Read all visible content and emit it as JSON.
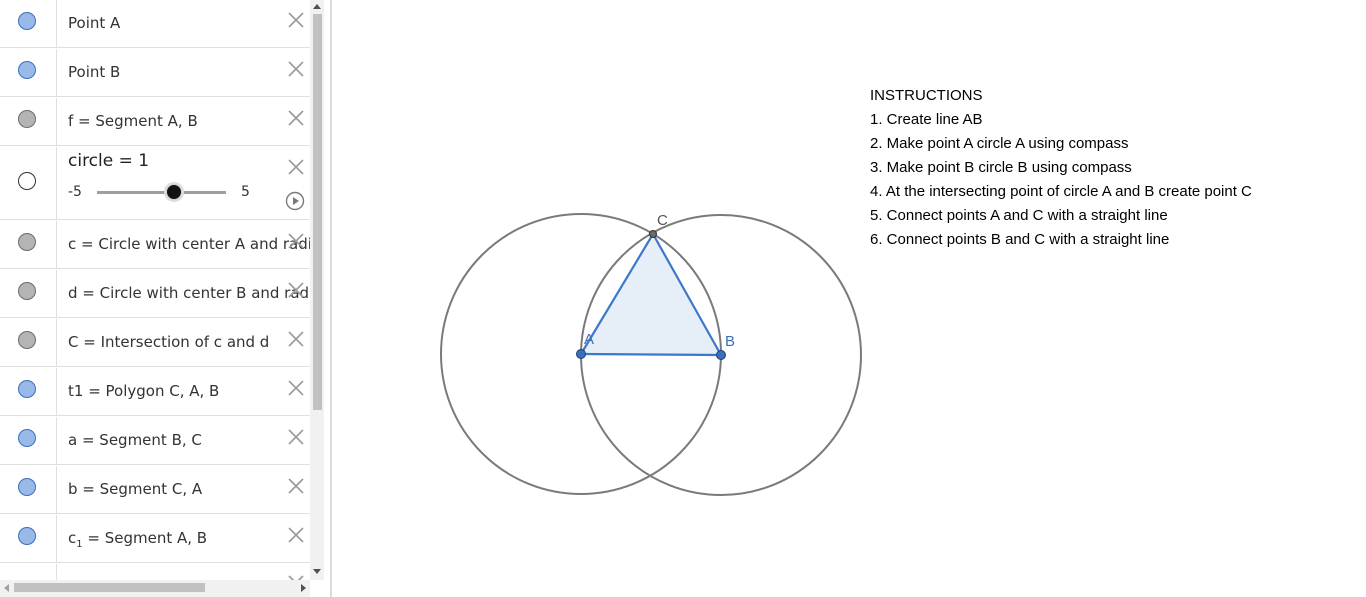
{
  "algebra_view": {
    "rows": [
      {
        "text": "Point A",
        "marble": "blue"
      },
      {
        "text": "Point B",
        "marble": "blue"
      },
      {
        "text": "f = Segment A, B",
        "marble": "gray"
      },
      {
        "text": "c = Circle with center A and radius",
        "marble": "gray"
      },
      {
        "text": "d = Circle with center B and radius",
        "marble": "gray"
      },
      {
        "text": "C = Intersection of c and d",
        "marble": "gray"
      },
      {
        "text": "t1 = Polygon C, A, B",
        "marble": "blue"
      },
      {
        "text": "a = Segment B, C",
        "marble": "blue"
      },
      {
        "text": "b = Segment C, A",
        "marble": "blue"
      },
      {
        "prefix": "c",
        "subscript": "1",
        "text": " = Segment A, B",
        "marble": "blue"
      }
    ],
    "slider": {
      "label": "circle = 1",
      "min": "-5",
      "max": "5",
      "value": 1,
      "marble": "empty"
    }
  },
  "graphics": {
    "points": {
      "A": "A",
      "B": "B",
      "C": "C"
    }
  },
  "instructions": {
    "title": "INSTRUCTIONS",
    "steps": [
      "1. Create line AB",
      "2. Make point A circle A using compass",
      "3. Make point B circle B using compass",
      "4. At the intersecting point of circle A and B create point C",
      "5. Connect points A and C with a straight line",
      "6. Connect points B and C with a straight line"
    ]
  },
  "colors": {
    "marble_blue": "#99b9e8",
    "marble_gray": "#b4b4b4",
    "marble_empty": "#ffffff",
    "circle_stroke": "#7a7a7a",
    "polygon_stroke": "#3c78c8",
    "polygon_fill": "#e6eef8",
    "point_fill": "#3a6fba",
    "point_c_fill": "#6b6b6b"
  }
}
